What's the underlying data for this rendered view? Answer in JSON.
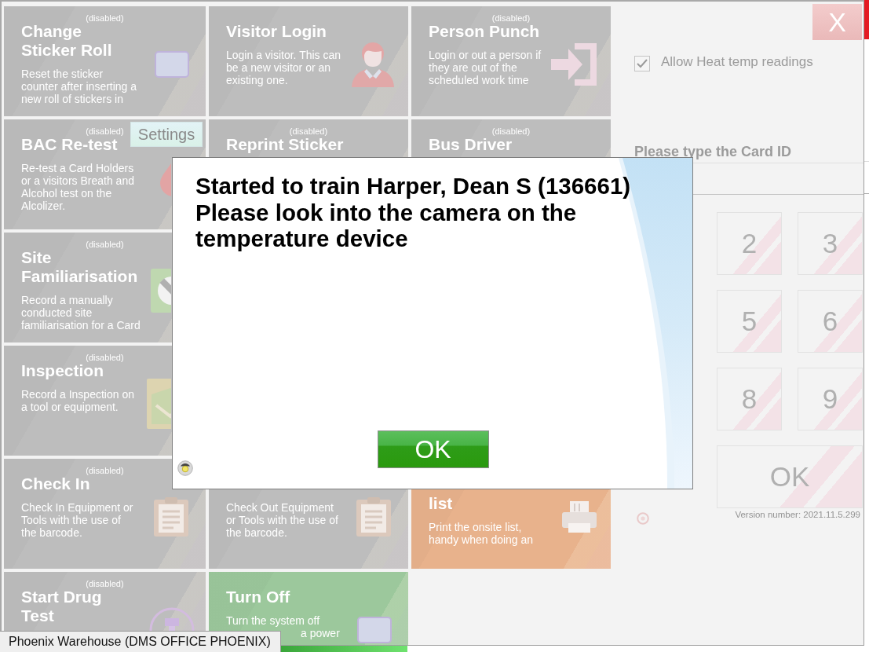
{
  "tiles": [
    {
      "kind": "tile",
      "color": "#bdbdbd",
      "note": "(disabled)",
      "title": "Change\nSticker Roll",
      "description": "Reset the sticker\ncounter after inserting a\nnew roll of stickers in"
    },
    {
      "kind": "tile",
      "color": "#bdbdbd",
      "title": "Visitor Login",
      "description": "Login a visitor. This can\nbe a new visitor or an\nexisting one."
    },
    {
      "kind": "tile",
      "color": "#bdbdbd",
      "note": "(disabled)",
      "title": "Person Punch",
      "description": "Login or out a person if\nthey are out of the\nscheduled work time"
    },
    {
      "kind": "tile",
      "color": "#bdbdbd",
      "note": "(disabled)",
      "title": "BAC Re-test",
      "description": "Re-test a Card Holders\nor a visitors Breath and\nAlcohol test on the\nAlcolizer.",
      "settings_button": "Settings"
    },
    {
      "kind": "tile",
      "color": "#bdbdbd",
      "note": "(disabled)",
      "title": "Reprint Sticker"
    },
    {
      "kind": "tile",
      "color": "#bdbdbd",
      "note": "(disabled)",
      "title": "Bus Driver"
    },
    {
      "kind": "tile",
      "color": "#bdbdbd",
      "note": "(disabled)",
      "title": "Site\nFamiliarisation",
      "description": "Record a manually\nconducted site\nfamiliarisation for a Card"
    },
    {
      "kind": "blank"
    },
    {
      "kind": "blank"
    },
    {
      "kind": "tile",
      "color": "#bdbdbd",
      "note": "(disabled)",
      "title": "Inspection",
      "description": "Record a Inspection on\na tool or equipment."
    },
    {
      "kind": "blank"
    },
    {
      "kind": "blank"
    },
    {
      "kind": "tile",
      "color": "#bdbdbd",
      "note": "(disabled)",
      "title": "Check In",
      "description": "Check In Equipment or\nTools with the use of\nthe barcode."
    },
    {
      "kind": "tile",
      "color": "#bdbdbd",
      "description": "Check Out Equipment\nor Tools with the use of\nthe barcode."
    },
    {
      "kind": "tile",
      "color": "#e8b28c",
      "title": "list",
      "description": "Print the onsite list,\nhandy when doing an"
    },
    {
      "kind": "tile",
      "color": "#bdbdbd",
      "note": "(disabled)",
      "title": "Start Drug\nTest"
    },
    {
      "kind": "tile",
      "color": "#9cc89c",
      "title": "Turn Off",
      "description": "Turn the system off",
      "description_cut": "a power"
    },
    {
      "kind": "blank"
    }
  ],
  "side_panel": {
    "close_button": "X",
    "checkbox": {
      "label": "Allow Heat temp readings",
      "checked": true
    },
    "card_id_label": "Please type the Card ID",
    "keypad": [
      {
        "kind": "covered"
      },
      {
        "kind": "digit",
        "label": "2"
      },
      {
        "kind": "digit",
        "label": "3"
      },
      {
        "kind": "covered"
      },
      {
        "kind": "digit",
        "label": "5"
      },
      {
        "kind": "digit",
        "label": "6"
      },
      {
        "kind": "covered"
      },
      {
        "kind": "digit",
        "label": "8"
      },
      {
        "kind": "digit",
        "label": "9"
      },
      {
        "kind": "covered"
      },
      {
        "kind": "wide",
        "label": "OK"
      }
    ],
    "version": "Version number: 2021.11.5.299"
  },
  "dialog": {
    "message": "Started to train Harper, Dean S (136661)\nPlease look into the camera on the temperature device",
    "button": "OK"
  },
  "status_bar": {
    "text": "Phoenix Warehouse (DMS OFFICE PHOENIX)"
  }
}
